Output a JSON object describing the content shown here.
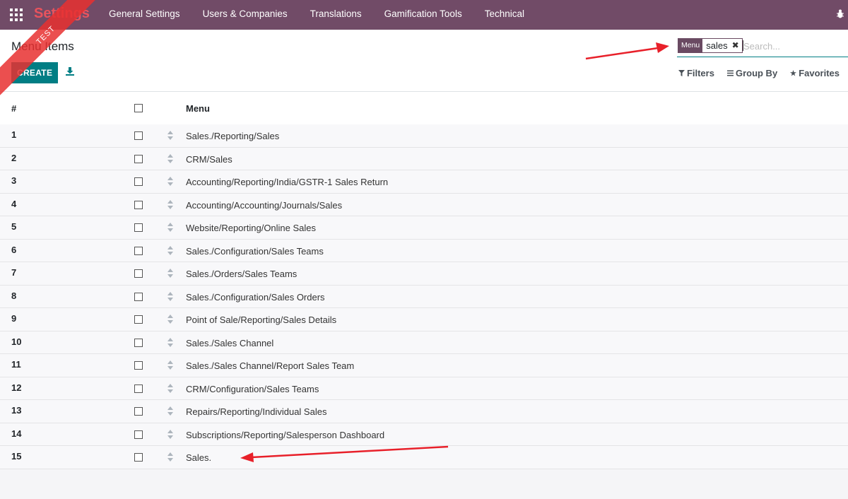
{
  "navbar": {
    "brand": "Settings",
    "menu": [
      "General Settings",
      "Users & Companies",
      "Translations",
      "Gamification Tools",
      "Technical"
    ]
  },
  "ribbon": {
    "label": "TEST"
  },
  "control_panel": {
    "breadcrumb": "Menu Items",
    "create_label": "CREATE",
    "search": {
      "facet_label": "Menu",
      "facet_value": "sales",
      "placeholder": "Search..."
    },
    "filters_label": "Filters",
    "group_by_label": "Group By",
    "favorites_label": "Favorites"
  },
  "table": {
    "headers": {
      "num": "#",
      "menu": "Menu"
    },
    "rows": [
      {
        "num": "1",
        "menu": "Sales./Reporting/Sales"
      },
      {
        "num": "2",
        "menu": "CRM/Sales"
      },
      {
        "num": "3",
        "menu": "Accounting/Reporting/India/GSTR-1 Sales Return"
      },
      {
        "num": "4",
        "menu": "Accounting/Accounting/Journals/Sales"
      },
      {
        "num": "5",
        "menu": "Website/Reporting/Online Sales"
      },
      {
        "num": "6",
        "menu": "Sales./Configuration/Sales Teams"
      },
      {
        "num": "7",
        "menu": "Sales./Orders/Sales Teams"
      },
      {
        "num": "8",
        "menu": "Sales./Configuration/Sales Orders"
      },
      {
        "num": "9",
        "menu": "Point of Sale/Reporting/Sales Details"
      },
      {
        "num": "10",
        "menu": "Sales./Sales Channel"
      },
      {
        "num": "11",
        "menu": "Sales./Sales Channel/Report Sales Team"
      },
      {
        "num": "12",
        "menu": "CRM/Configuration/Sales Teams"
      },
      {
        "num": "13",
        "menu": "Repairs/Reporting/Individual Sales"
      },
      {
        "num": "14",
        "menu": "Subscriptions/Reporting/Salesperson Dashboard"
      },
      {
        "num": "15",
        "menu": "Sales."
      }
    ]
  },
  "colors": {
    "navbar": "#714b67",
    "brand": "#e9535d",
    "primary_button": "#017e84",
    "annotation_arrow": "#e8202a"
  }
}
